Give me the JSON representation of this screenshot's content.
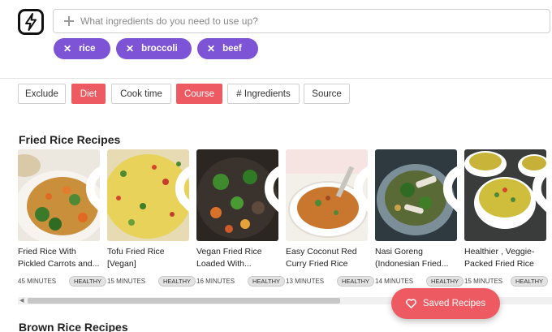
{
  "search": {
    "placeholder": "What ingredients do you need to use up?",
    "value": ""
  },
  "chips": [
    {
      "label": "rice",
      "remove": "✕"
    },
    {
      "label": "broccoli",
      "remove": "✕"
    },
    {
      "label": "beef",
      "remove": "✕"
    }
  ],
  "filters": [
    "Exclude",
    "Diet",
    "Cook time",
    "Course",
    "# Ingredients",
    "Source"
  ],
  "active_filters": [
    "Diet",
    "Course"
  ],
  "sections": {
    "fried_rice": "Fried Rice Recipes",
    "brown_rice": "Brown Rice Recipes"
  },
  "recipes": [
    {
      "title_line1": "Fried Rice With",
      "title_line2": "Pickled Carrots and...",
      "time": "45 MINUTES",
      "badge": "HEALTHY"
    },
    {
      "title_line1": "Tofu Fried Rice",
      "title_line2": "[Vegan]",
      "time": "15 MINUTES",
      "badge": "HEALTHY"
    },
    {
      "title_line1": "Vegan Fried Rice",
      "title_line2": "Loaded With...",
      "time": "16 MINUTES",
      "badge": "HEALTHY"
    },
    {
      "title_line1": "Easy Coconut Red",
      "title_line2": "Curry Fried Rice",
      "time": "13 MINUTES",
      "badge": "HEALTHY"
    },
    {
      "title_line1": "Nasi Goreng",
      "title_line2": "(Indonesian Fried...",
      "time": "14 MINUTES",
      "badge": "HEALTHY"
    },
    {
      "title_line1": "Healthier , Veggie-",
      "title_line2": "Packed Fried Rice",
      "time": "15 MINUTES",
      "badge": "HEALTHY"
    }
  ],
  "saved_button": {
    "label": "Saved Recipes"
  },
  "colors": {
    "accent_purple": "#7d54d6",
    "accent_red": "#ee5a62"
  },
  "icons": {
    "logo": "lightning-bolt-icon",
    "add": "plus-icon",
    "favorite": "heart-outline-icon"
  }
}
